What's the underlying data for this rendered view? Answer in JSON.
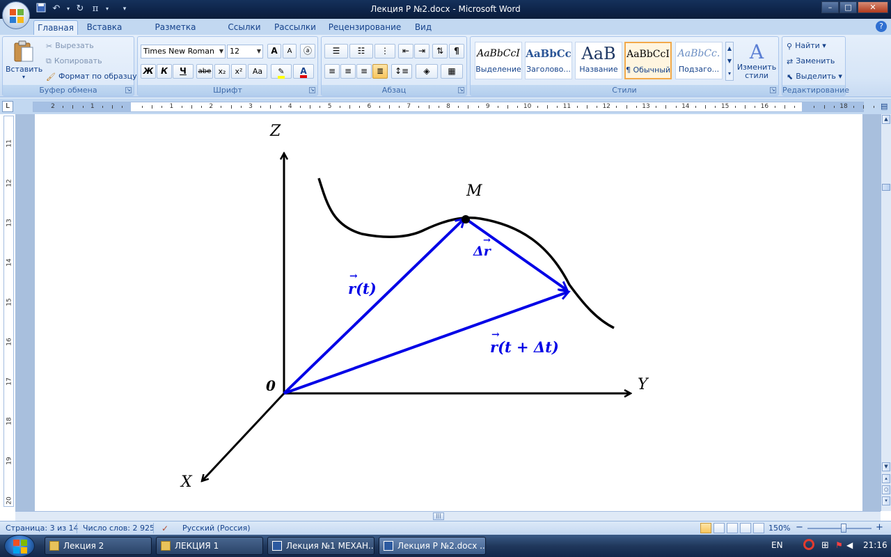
{
  "window": {
    "title": "Лекция Р №2.docx - Microsoft Word",
    "controls": {
      "minimize": "–",
      "maximize": "□",
      "close": "✕"
    },
    "qat_pi": "π"
  },
  "ribbon": {
    "tabs": [
      {
        "label": "Главная",
        "active": true
      },
      {
        "label": "Вставка"
      },
      {
        "label": "Разметка страницы"
      },
      {
        "label": "Ссылки"
      },
      {
        "label": "Рассылки"
      },
      {
        "label": "Рецензирование"
      },
      {
        "label": "Вид"
      }
    ],
    "clipboard": {
      "label": "Буфер обмена",
      "paste": "Вставить",
      "cut": "Вырезать",
      "copy": "Копировать",
      "format_painter": "Формат по образцу"
    },
    "font": {
      "label": "Шрифт",
      "font_name": "Times New Roman",
      "font_size": "12",
      "bold": "Ж",
      "italic": "К",
      "underline": "Ч",
      "strike": "abe",
      "subscript": "x₂",
      "superscript": "x²",
      "change_case": "Aa",
      "grow": "A",
      "shrink": "A",
      "font_color": "A"
    },
    "paragraph": {
      "label": "Абзац",
      "pilcrow": "¶"
    },
    "styles": {
      "label": "Стили",
      "items": [
        {
          "sample": "AaBbCcI",
          "name": "Выделение"
        },
        {
          "sample": "AaBbCc",
          "name": "Заголово..."
        },
        {
          "sample": "AaB",
          "name": "Название"
        },
        {
          "sample": "AaBbCcI",
          "name": "¶ Обычный",
          "selected": true
        },
        {
          "sample": "AaBbCc.",
          "name": "Подзаго..."
        }
      ],
      "change_styles": "Изменить стили"
    },
    "editing": {
      "label": "Редактирование",
      "find": "Найти",
      "replace": "Заменить",
      "select": "Выделить"
    }
  },
  "ruler": {
    "corner": "L",
    "numbers": [
      "2",
      "1",
      "",
      "1",
      "2",
      "3",
      "4",
      "5",
      "6",
      "7",
      "8",
      "9",
      "10",
      "11",
      "12",
      "13",
      "14",
      "15",
      "16",
      "",
      "18"
    ],
    "vertical_numbers": [
      "11",
      "12",
      "13",
      "14",
      "15",
      "16",
      "17",
      "18",
      "19",
      "20"
    ]
  },
  "document": {
    "labels": {
      "z_axis": "Z",
      "y_axis": "Y",
      "x_axis": "X",
      "origin": "0",
      "point_m": "M",
      "vec_r_t": "r(t)",
      "vec_delta_r": "Δr",
      "vec_r_t_dt": "r(t + Δt)"
    },
    "colors": {
      "vectors": "#0000e6",
      "curve": "#000000",
      "axes": "#000000"
    }
  },
  "statusbar": {
    "page": "Страница: 3 из 14",
    "words": "Число слов: 2 925",
    "language": "Русский (Россия)",
    "zoom": "150%",
    "zoom_minus": "−",
    "zoom_plus": "+"
  },
  "taskbar": {
    "tasks": [
      {
        "label": "Лекция 2"
      },
      {
        "label": "ЛЕКЦИЯ 1"
      },
      {
        "label": "Лекция №1 МЕХАН..."
      },
      {
        "label": "Лекция Р №2.docx ...",
        "active": true
      }
    ],
    "lang": "EN",
    "clock": "21:16"
  }
}
